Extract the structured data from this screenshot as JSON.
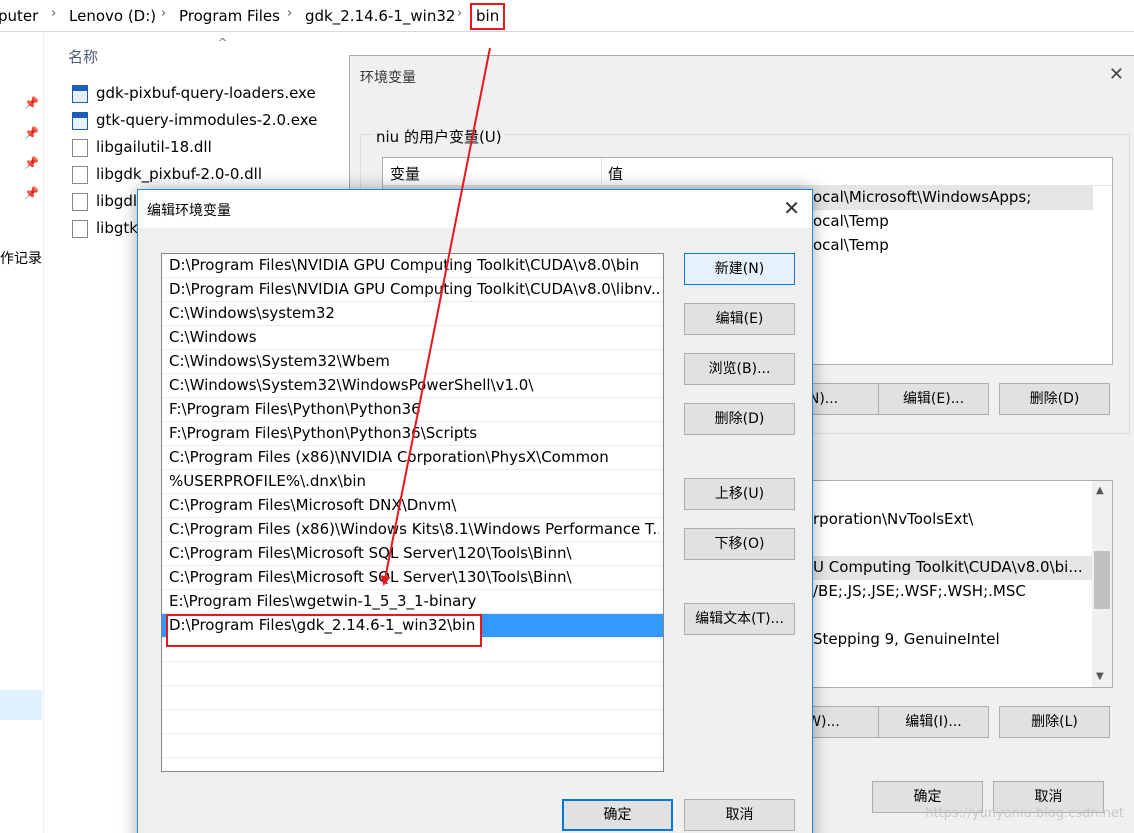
{
  "explorer": {
    "breadcrumbs": [
      "puter",
      "Lenovo (D:)",
      "Program Files",
      "gdk_2.14.6-1_win32",
      "bin"
    ],
    "column_name": "名称",
    "quick_access_label": "作记录",
    "files": [
      {
        "name": "gdk-pixbuf-query-loaders.exe",
        "icon": "exe-icon"
      },
      {
        "name": "gtk-query-immodules-2.0.exe",
        "icon": "exe-icon"
      },
      {
        "name": "libgailutil-18.dll",
        "icon": "dll-icon"
      },
      {
        "name": "libgdk_pixbuf-2.0-0.dll",
        "icon": "dll-icon"
      },
      {
        "name": "libgdl",
        "icon": "dll-icon"
      },
      {
        "name": "libgtk",
        "icon": "dll-icon"
      }
    ]
  },
  "env_dialog": {
    "title": "环境变量",
    "user_group_label": "niu 的用户变量(U)",
    "user_headers": {
      "var": "变量",
      "val": "值"
    },
    "user_rows": [
      "ocal\\Microsoft\\WindowsApps;",
      "ocal\\Temp",
      "ocal\\Temp"
    ],
    "user_buttons": {
      "new": "N)...",
      "edit": "编辑(E)...",
      "delete": "删除(D)"
    },
    "sys_rows": [
      "rporation\\NvToolsExt\\",
      "",
      "U Computing Toolkit\\CUDA\\v8.0\\bi...",
      "/BE;.JS;.JSE;.WSF;.WSH;.MSC",
      "",
      "Stepping 9, GenuineIntel"
    ],
    "sys_buttons": {
      "new": "W)...",
      "edit": "编辑(I)...",
      "delete": "删除(L)"
    },
    "ok": "确定",
    "cancel": "取消"
  },
  "edit_dialog": {
    "title": "编辑环境变量",
    "paths": [
      "D:\\Program Files\\NVIDIA GPU Computing Toolkit\\CUDA\\v8.0\\bin",
      "D:\\Program Files\\NVIDIA GPU Computing Toolkit\\CUDA\\v8.0\\libnv...",
      "C:\\Windows\\system32",
      "C:\\Windows",
      "C:\\Windows\\System32\\Wbem",
      "C:\\Windows\\System32\\WindowsPowerShell\\v1.0\\",
      "F:\\Program Files\\Python\\Python36",
      "F:\\Program Files\\Python\\Python36\\Scripts",
      "C:\\Program Files (x86)\\NVIDIA Corporation\\PhysX\\Common",
      "%USERPROFILE%\\.dnx\\bin",
      "C:\\Program Files\\Microsoft DNX\\Dnvm\\",
      "C:\\Program Files (x86)\\Windows Kits\\8.1\\Windows Performance T...",
      "C:\\Program Files\\Microsoft SQL Server\\120\\Tools\\Binn\\",
      "C:\\Program Files\\Microsoft SQL Server\\130\\Tools\\Binn\\",
      "E:\\Program Files\\wgetwin-1_5_3_1-binary",
      "D:\\Program Files\\gdk_2.14.6-1_win32\\bin",
      "",
      "",
      "",
      "",
      ""
    ],
    "selected_index": 15,
    "buttons": {
      "new": "新建(N)",
      "edit": "编辑(E)",
      "browse": "浏览(B)...",
      "delete": "删除(D)",
      "move_up": "上移(U)",
      "move_down": "下移(O)",
      "edit_text": "编辑文本(T)..."
    },
    "ok": "确定",
    "cancel": "取消"
  },
  "watermark": "https://yunyaniu.blog.csdn.net",
  "colors": {
    "highlight": "#e8171d",
    "selection": "#3399ff",
    "accent": "#0078d7"
  }
}
